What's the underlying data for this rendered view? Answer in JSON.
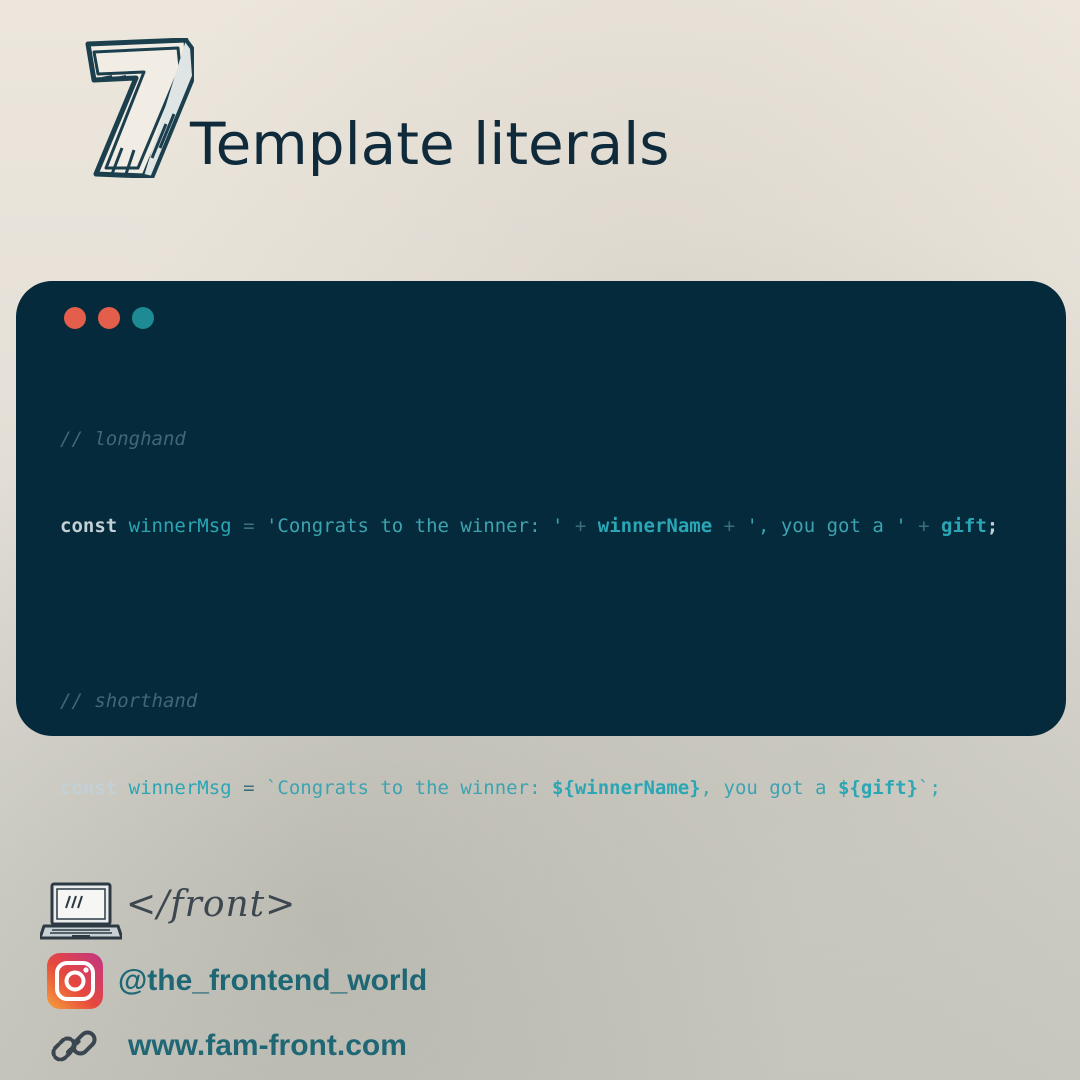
{
  "header": {
    "number": "7",
    "title": "Template literals"
  },
  "editor": {
    "window_dots": [
      {
        "name": "close-dot",
        "color": "#e35f4b"
      },
      {
        "name": "minimize-dot",
        "color": "#e35f4b"
      },
      {
        "name": "maximize-dot",
        "color": "#1e8a94"
      }
    ],
    "longhand": {
      "comment": "// longhand",
      "keyword": "const",
      "var_name": "winnerMsg",
      "eq": "=",
      "str1": "'Congrats to the winner: '",
      "plus1": "+",
      "ref1": "winnerName",
      "plus2": "+",
      "str2": "', you got a '",
      "plus3": "+",
      "ref2": "gift",
      "end": ";"
    },
    "shorthand": {
      "comment": "// shorthand",
      "keyword": "const",
      "var_name": "winnerMsg",
      "eq": "=",
      "tpl_start": "`Congrats to the winner: ",
      "interp1": "${winnerName}",
      "tpl_mid": ", you got a ",
      "interp2": "${gift}",
      "tpl_end": "`;"
    }
  },
  "footer": {
    "brand": "</front>",
    "instagram_handle": "@the_frontend_world",
    "website": "www.fam-front.com"
  }
}
